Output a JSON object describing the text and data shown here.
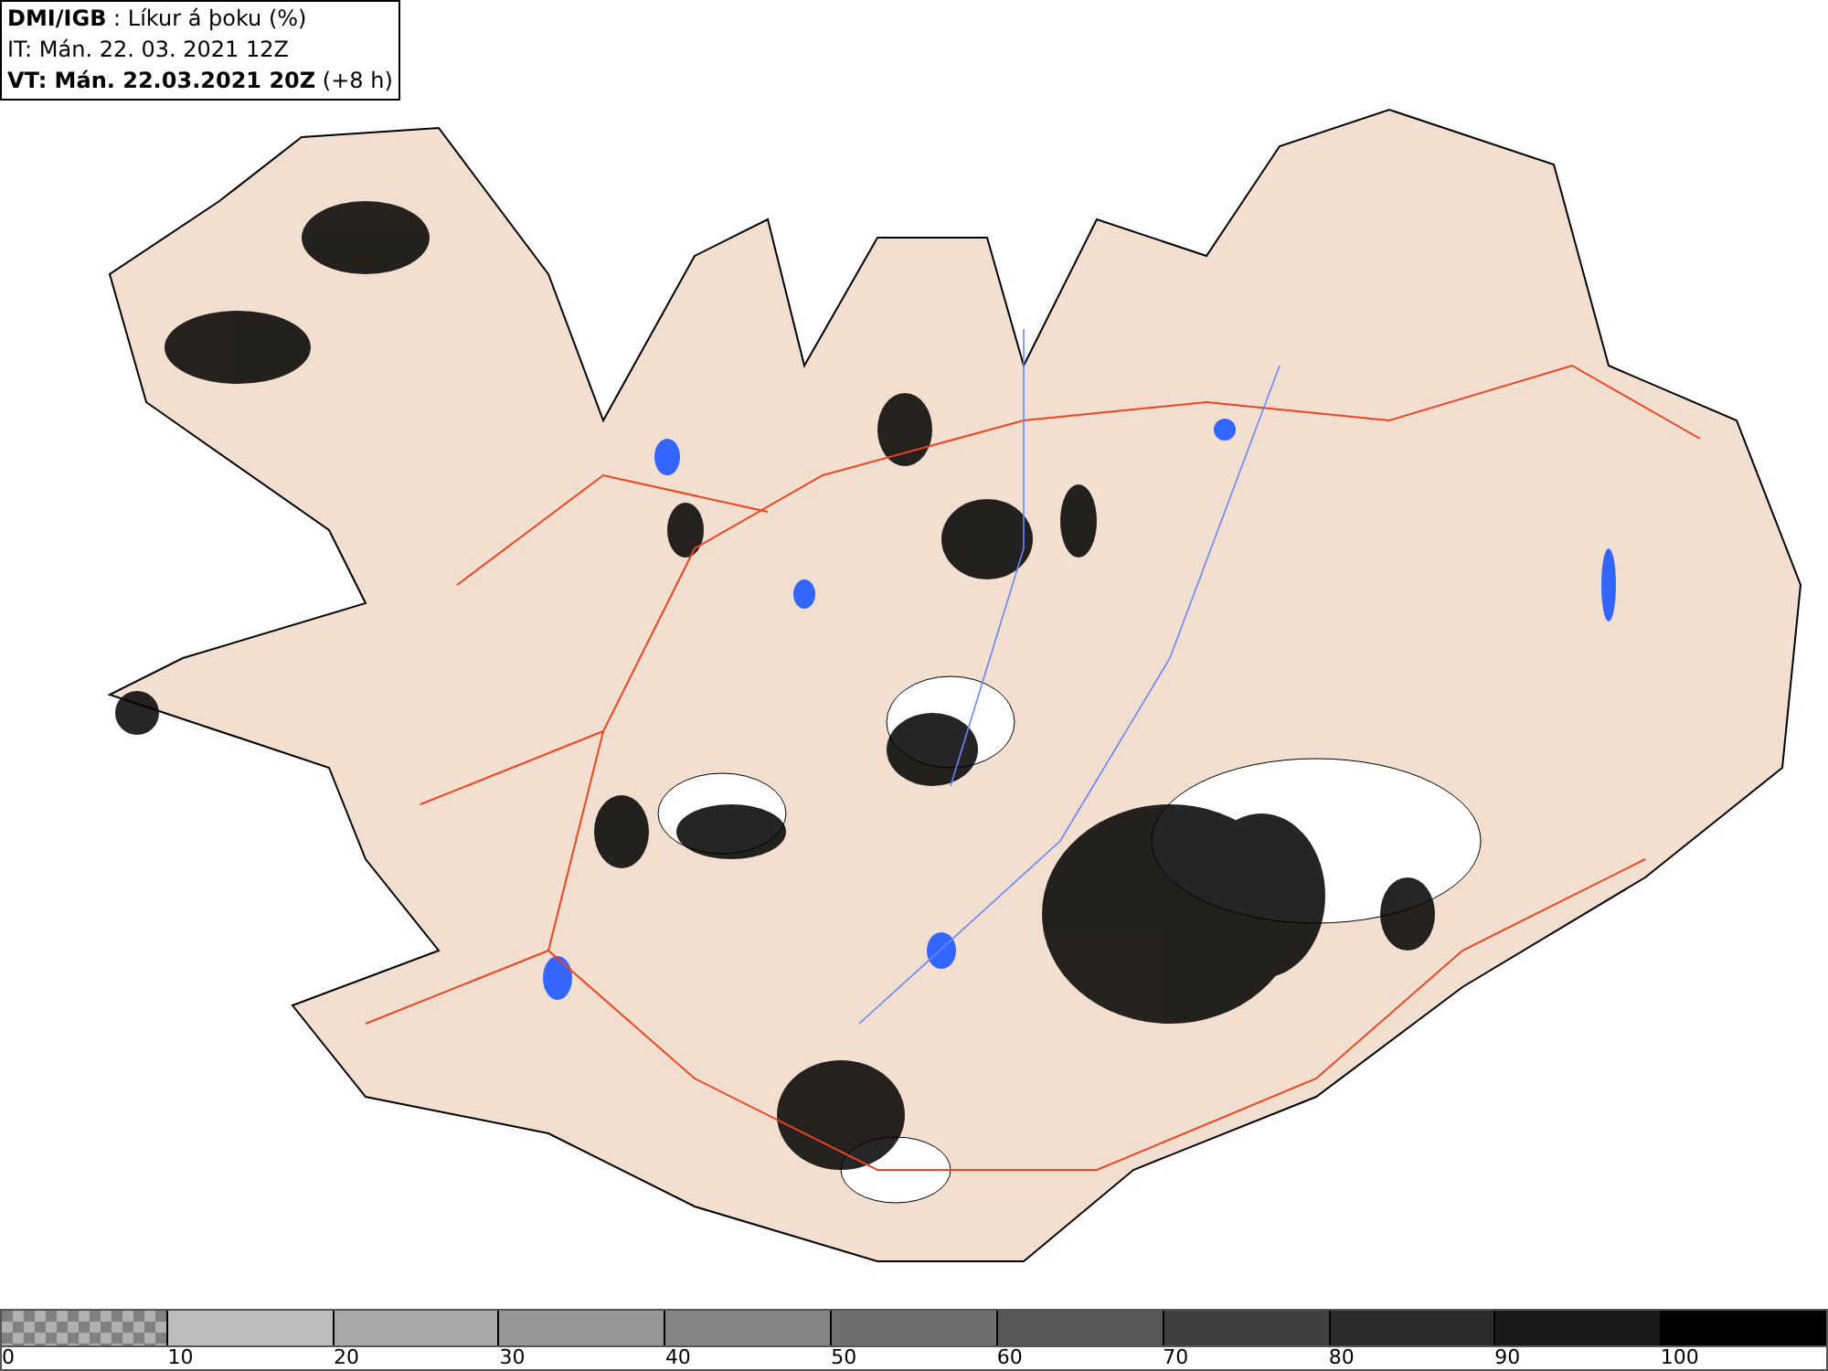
{
  "header": {
    "lines": [
      "**DMI/IGB** : Líkur á þoku (%)",
      "IT: Mán. 22. 03. 2021 12Z",
      "**VT: Mán. 22.03.2021 20Z** (+8 h)"
    ]
  },
  "legend": {
    "segments": [
      {
        "kind": "checker",
        "color": "#808080"
      },
      {
        "kind": "solid",
        "color": "#bdbdbd"
      },
      {
        "kind": "solid",
        "color": "#a9a9a9"
      },
      {
        "kind": "solid",
        "color": "#969696"
      },
      {
        "kind": "solid",
        "color": "#838383"
      },
      {
        "kind": "solid",
        "color": "#6f6f6f"
      },
      {
        "kind": "solid",
        "color": "#565656"
      },
      {
        "kind": "solid",
        "color": "#3f3f3f"
      },
      {
        "kind": "solid",
        "color": "#2b2b2b"
      },
      {
        "kind": "solid",
        "color": "#181818"
      },
      {
        "kind": "solid",
        "color": "#000000"
      }
    ],
    "labels": [
      "0",
      "10",
      "20",
      "30",
      "40",
      "50",
      "60",
      "70",
      "80",
      "90",
      "100"
    ]
  }
}
